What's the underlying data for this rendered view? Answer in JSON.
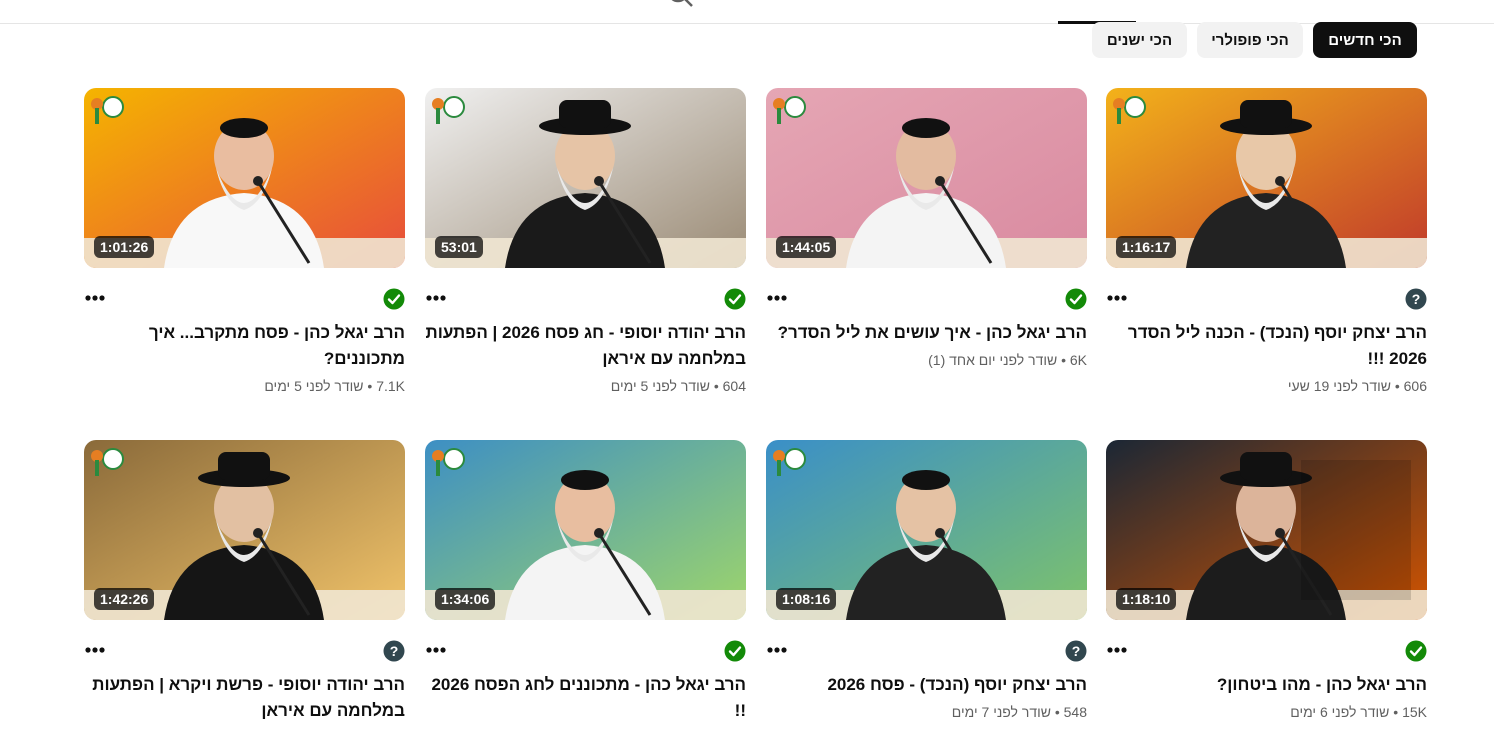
{
  "top_tabs": [
    "...",
    "...",
    "...",
    "...",
    "...",
    "...",
    "...",
    "..."
  ],
  "filter_chips": [
    {
      "label": "הכי חדשים",
      "selected": true
    },
    {
      "label": "הכי פופולרי",
      "selected": false
    },
    {
      "label": "הכי ישנים",
      "selected": false
    }
  ],
  "videos": [
    {
      "title": "הרב יצחק יוסף (הנכד) - הכנה ליל הסדר 2026 !!!",
      "duration": "1:16:17",
      "views": "606",
      "age": "שודר לפני 19 שעי",
      "status": "unknown"
    },
    {
      "title": "הרב יגאל כהן - איך עושים את ליל הסדר?",
      "duration": "1:44:05",
      "views": "6K",
      "age": "שודר לפני יום אחד (1)",
      "status": "verified"
    },
    {
      "title": "הרב יהודה יוסופי - חג פסח 2026 | הפתעות במלחמה עם איראן",
      "duration": "53:01",
      "views": "604",
      "age": "שודר לפני 5 ימים",
      "status": "verified"
    },
    {
      "title": "הרב יגאל כהן - פסח מתקרב... איך מתכוננים?",
      "duration": "1:01:26",
      "views": "7.1K",
      "age": "שודר לפני 5 ימים",
      "status": "verified"
    },
    {
      "title": "הרב יגאל כהן - מהו ביטחון?",
      "duration": "1:18:10",
      "views": "15K",
      "age": "שודר לפני 6 ימים",
      "status": "verified"
    },
    {
      "title": "הרב יצחק יוסף (הנכד) - פסח 2026",
      "duration": "1:08:16",
      "views": "548",
      "age": "שודר לפני 7 ימים",
      "status": "unknown"
    },
    {
      "title": "הרב יגאל כהן - מתכוננים לחג הפסח 2026 !!",
      "duration": "1:34:06",
      "views": "",
      "age": "",
      "status": "verified"
    },
    {
      "title": "הרב יהודה יוסופי - פרשת ויקרא | הפתעות במלחמה עם איראן",
      "duration": "1:42:26",
      "views": "",
      "age": "",
      "status": "unknown"
    }
  ],
  "colors": {
    "verified": "#138a08",
    "unknown": "#31474f",
    "chip_selected": "#0f0f0f",
    "chip": "#f2f2f2"
  }
}
